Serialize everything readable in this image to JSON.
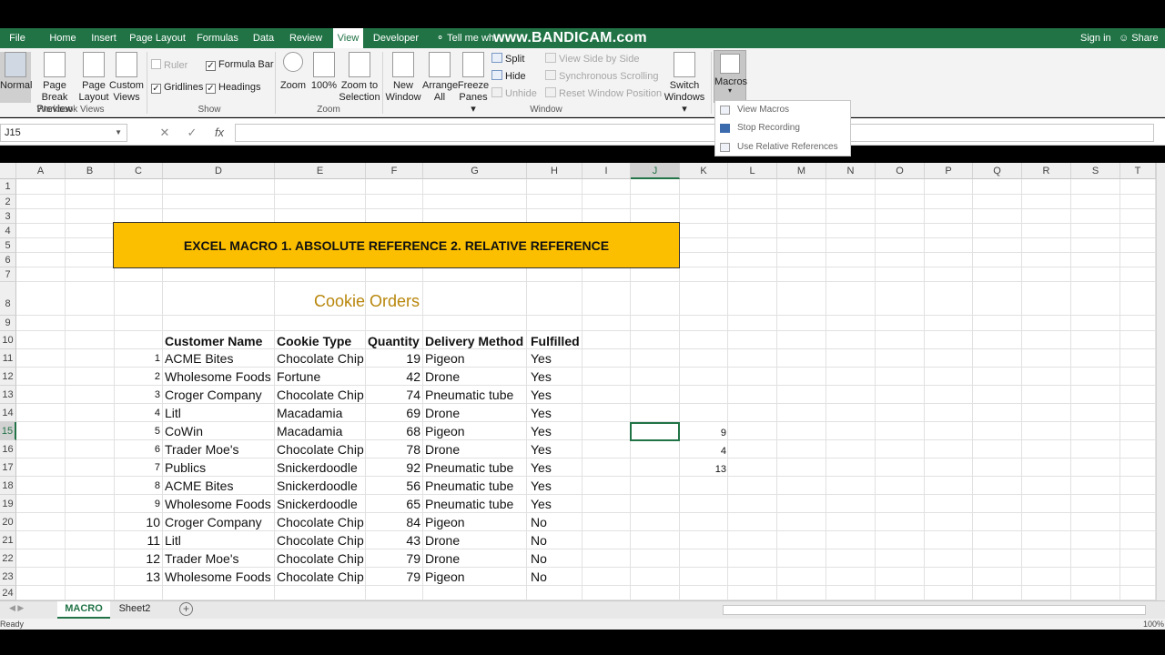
{
  "tabs": [
    "File",
    "Home",
    "Insert",
    "Page Layout",
    "Formulas",
    "Data",
    "Review",
    "View",
    "Developer"
  ],
  "active_tab": "View",
  "tell_me": "Tell me wh",
  "watermark": "www.BANDICAM.com",
  "sign_in": "Sign in",
  "share": "Share",
  "ribbon": {
    "workbook_views": {
      "label": "Workbook Views",
      "normal": "Normal",
      "page_break_1": "Page Break",
      "page_break_2": "Preview",
      "page_layout_1": "Page",
      "page_layout_2": "Layout",
      "custom_1": "Custom",
      "custom_2": "Views"
    },
    "show": {
      "label": "Show",
      "ruler": "Ruler",
      "formula_bar": "Formula Bar",
      "gridlines": "Gridlines",
      "headings": "Headings"
    },
    "zoom": {
      "label": "Zoom",
      "zoom": "Zoom",
      "hundred": "100%",
      "zoom_sel_1": "Zoom to",
      "zoom_sel_2": "Selection"
    },
    "window": {
      "label": "Window",
      "new_1": "New",
      "new_2": "Window",
      "arrange_1": "Arrange",
      "arrange_2": "All",
      "freeze_1": "Freeze",
      "freeze_2": "Panes ▾",
      "split": "Split",
      "hide": "Hide",
      "unhide": "Unhide",
      "side_by_side": "View Side by Side",
      "sync_scroll": "Synchronous Scrolling",
      "reset_pos": "Reset Window Position",
      "switch_1": "Switch",
      "switch_2": "Windows ▾"
    },
    "macros": {
      "label": "Macros",
      "arrow": "▾"
    }
  },
  "macros_menu": [
    "View Macros",
    "Stop Recording",
    "Use Relative References"
  ],
  "name_box": "J15",
  "fx": "fx",
  "columns": [
    "A",
    "B",
    "C",
    "D",
    "E",
    "F",
    "G",
    "H",
    "I",
    "J",
    "K",
    "L",
    "M",
    "N",
    "O",
    "P",
    "Q",
    "R",
    "S",
    "T"
  ],
  "rows": [
    "1",
    "2",
    "3",
    "4",
    "5",
    "6",
    "7",
    "8",
    "9",
    "10",
    "11",
    "12",
    "13",
    "14",
    "15",
    "16",
    "17",
    "18",
    "19",
    "20",
    "21",
    "22",
    "23",
    "24"
  ],
  "banner": "EXCEL MACRO 1. ABSOLUTE REFERENCE 2. RELATIVE REFERENCE",
  "table_title": "Cookie Orders",
  "table_headers": [
    "Customer Name",
    "Cookie Type",
    "Quantity",
    "Delivery Method",
    "Fulfilled"
  ],
  "table_rows": [
    {
      "idx": "1",
      "name": "ACME Bites",
      "type": "Chocolate Chip",
      "qty": "19",
      "method": "Pigeon",
      "ful": "Yes"
    },
    {
      "idx": "2",
      "name": "Wholesome Foods",
      "type": "Fortune",
      "qty": "42",
      "method": "Drone",
      "ful": "Yes"
    },
    {
      "idx": "3",
      "name": "Croger Company",
      "type": "Chocolate Chip",
      "qty": "74",
      "method": "Pneumatic tube",
      "ful": "Yes"
    },
    {
      "idx": "4",
      "name": "Litl",
      "type": "Macadamia",
      "qty": "69",
      "method": "Drone",
      "ful": "Yes"
    },
    {
      "idx": "5",
      "name": "CoWin",
      "type": "Macadamia",
      "qty": "68",
      "method": "Pigeon",
      "ful": "Yes"
    },
    {
      "idx": "6",
      "name": "Trader Moe's",
      "type": "Chocolate Chip",
      "qty": "78",
      "method": "Drone",
      "ful": "Yes"
    },
    {
      "idx": "7",
      "name": "Publics",
      "type": "Snickerdoodle",
      "qty": "92",
      "method": "Pneumatic tube",
      "ful": "Yes"
    },
    {
      "idx": "8",
      "name": "ACME Bites",
      "type": "Snickerdoodle",
      "qty": "56",
      "method": "Pneumatic tube",
      "ful": "Yes"
    },
    {
      "idx": "9",
      "name": "Wholesome Foods",
      "type": "Snickerdoodle",
      "qty": "65",
      "method": "Pneumatic tube",
      "ful": "Yes"
    },
    {
      "idx": "10",
      "name": "Croger Company",
      "type": "Chocolate Chip",
      "qty": "84",
      "method": "Pigeon",
      "ful": "No"
    },
    {
      "idx": "11",
      "name": "Litl",
      "type": "Chocolate Chip",
      "qty": "43",
      "method": "Drone",
      "ful": "No"
    },
    {
      "idx": "12",
      "name": "Trader Moe's",
      "type": "Chocolate Chip",
      "qty": "79",
      "method": "Drone",
      "ful": "No"
    },
    {
      "idx": "13",
      "name": "Wholesome Foods",
      "type": "Chocolate Chip",
      "qty": "79",
      "method": "Pigeon",
      "ful": "No"
    }
  ],
  "k_values": [
    "9",
    "4",
    "13"
  ],
  "sheets": [
    "MACRO",
    "Sheet2"
  ],
  "status": "Ready",
  "zoom_level": "100%"
}
